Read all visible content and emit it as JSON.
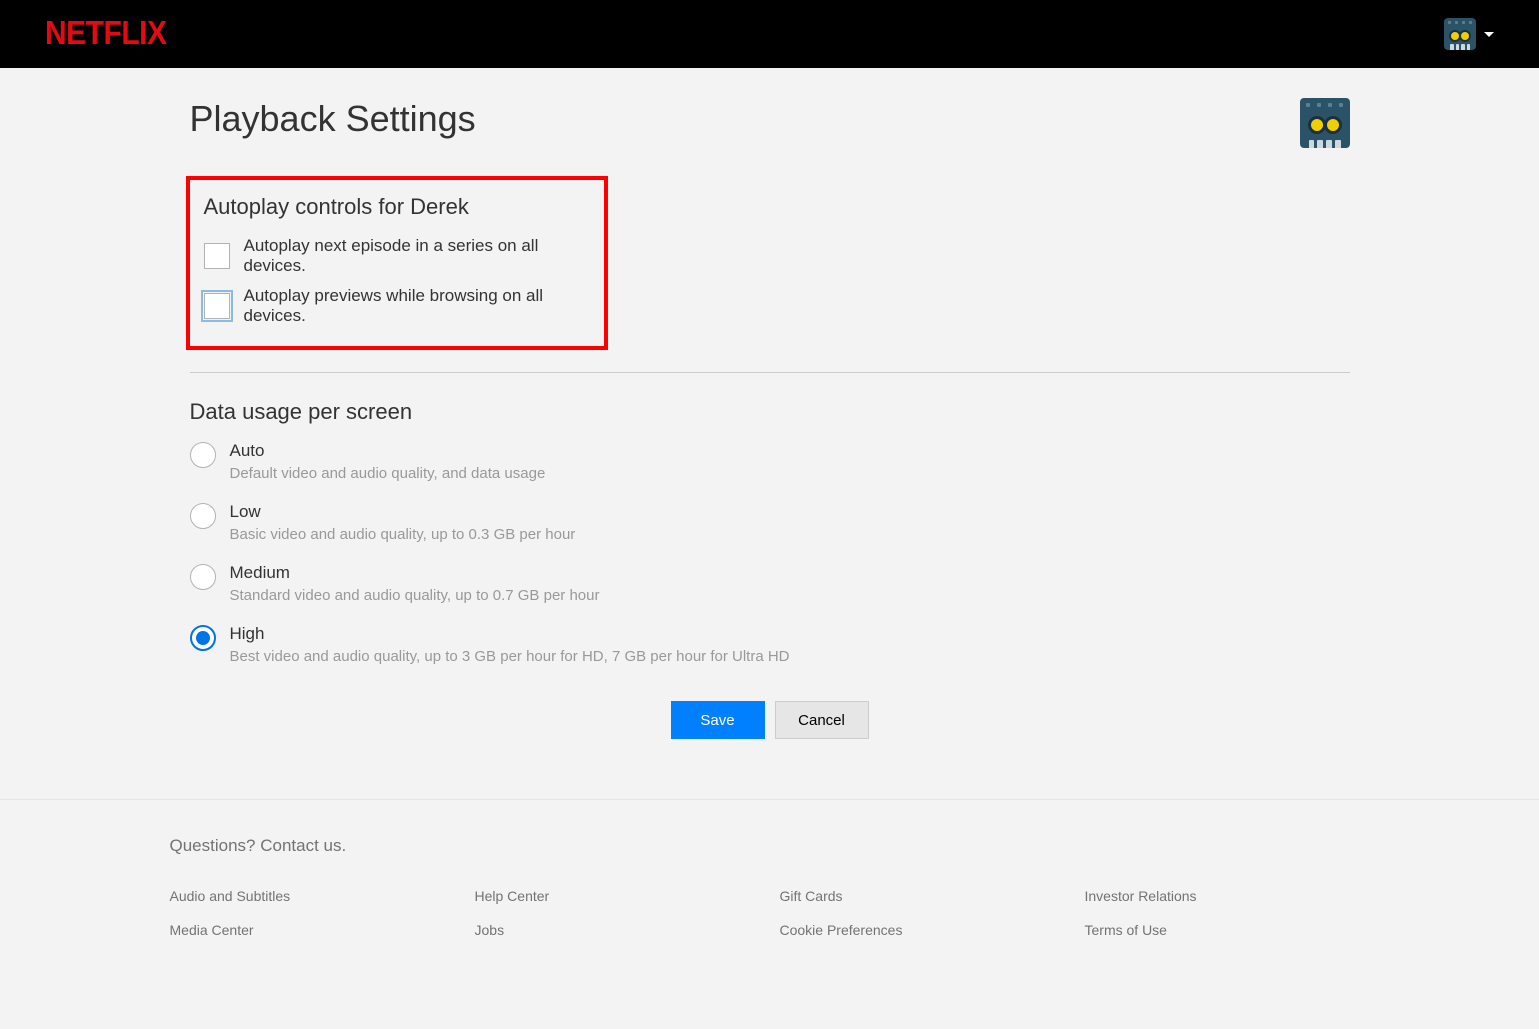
{
  "brand": "NETFLIX",
  "page": {
    "title": "Playback Settings"
  },
  "autoplay": {
    "heading": "Autoplay controls for Derek",
    "options": [
      {
        "label": "Autoplay next episode in a series on all devices.",
        "checked": false,
        "focused": false
      },
      {
        "label": "Autoplay previews while browsing on all devices.",
        "checked": false,
        "focused": true
      }
    ]
  },
  "dataUsage": {
    "heading": "Data usage per screen",
    "options": [
      {
        "label": "Auto",
        "desc": "Default video and audio quality, and data usage",
        "selected": false
      },
      {
        "label": "Low",
        "desc": "Basic video and audio quality, up to 0.3 GB per hour",
        "selected": false
      },
      {
        "label": "Medium",
        "desc": "Standard video and audio quality, up to 0.7 GB per hour",
        "selected": false
      },
      {
        "label": "High",
        "desc": "Best video and audio quality, up to 3 GB per hour for HD, 7 GB per hour for Ultra HD",
        "selected": true
      }
    ]
  },
  "buttons": {
    "save": "Save",
    "cancel": "Cancel"
  },
  "footer": {
    "questions": "Questions? Contact us.",
    "links": [
      "Audio and Subtitles",
      "Help Center",
      "Gift Cards",
      "Investor Relations",
      "Media Center",
      "Jobs",
      "Cookie Preferences",
      "Terms of Use"
    ]
  },
  "colors": {
    "brand_red": "#e50914",
    "primary_blue": "#0080ff",
    "highlight_red": "#ff0000"
  }
}
